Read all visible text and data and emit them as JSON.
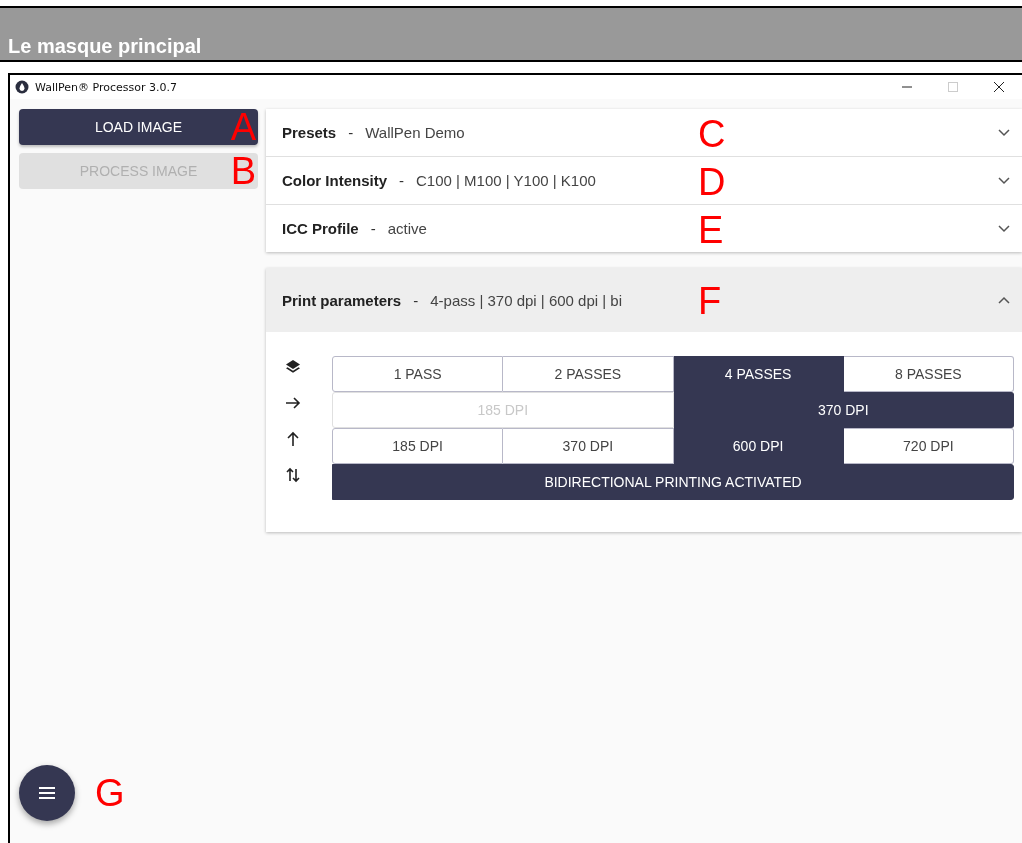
{
  "heading": "Le masque principal",
  "window": {
    "title": "WallPen® Processor 3.0.7",
    "controls": [
      {
        "kind": "minimize",
        "disabled": false
      },
      {
        "kind": "maximize",
        "disabled": true
      },
      {
        "kind": "close",
        "disabled": false
      }
    ]
  },
  "sidebar": {
    "buttons": [
      {
        "label": "LOAD IMAGE",
        "disabled": false,
        "marker": "A"
      },
      {
        "label": "PROCESS IMAGE",
        "disabled": true,
        "marker": "B"
      }
    ]
  },
  "panels": [
    {
      "title": "Presets",
      "separator": "-",
      "summary": "WallPen Demo",
      "expanded": false,
      "marker": "C"
    },
    {
      "title": "Color Intensity",
      "separator": "-",
      "summary": "C100 | M100 | Y100 | K100",
      "expanded": false,
      "marker": "D"
    },
    {
      "title": "ICC Profile",
      "separator": "-",
      "summary": "active",
      "expanded": false,
      "marker": "E"
    },
    {
      "title": "Print parameters",
      "separator": "-",
      "summary": "4-pass | 370 dpi | 600 dpi | bi",
      "expanded": true,
      "marker": "F",
      "rows": [
        {
          "kind": "layers",
          "options": [
            {
              "label": "1 PASS",
              "selected": false,
              "disabled": false
            },
            {
              "label": "2 PASSES",
              "selected": false,
              "disabled": false
            },
            {
              "label": "4 PASSES",
              "selected": true,
              "disabled": false
            },
            {
              "label": "8 PASSES",
              "selected": false,
              "disabled": false
            }
          ]
        },
        {
          "kind": "horizontal",
          "options": [
            {
              "label": "185 DPI",
              "selected": false,
              "disabled": true
            },
            {
              "label": "370 DPI",
              "selected": true,
              "disabled": false
            }
          ]
        },
        {
          "kind": "vertical",
          "options": [
            {
              "label": "185 DPI",
              "selected": false,
              "disabled": false
            },
            {
              "label": "370 DPI",
              "selected": false,
              "disabled": false
            },
            {
              "label": "600 DPI",
              "selected": true,
              "disabled": false
            },
            {
              "label": "720 DPI",
              "selected": false,
              "disabled": false
            }
          ]
        },
        {
          "kind": "bidirectional",
          "options": [
            {
              "label": "BIDIRECTIONAL PRINTING ACTIVATED",
              "selected": true,
              "disabled": false
            }
          ]
        }
      ]
    }
  ],
  "fab": {
    "marker": "G"
  }
}
